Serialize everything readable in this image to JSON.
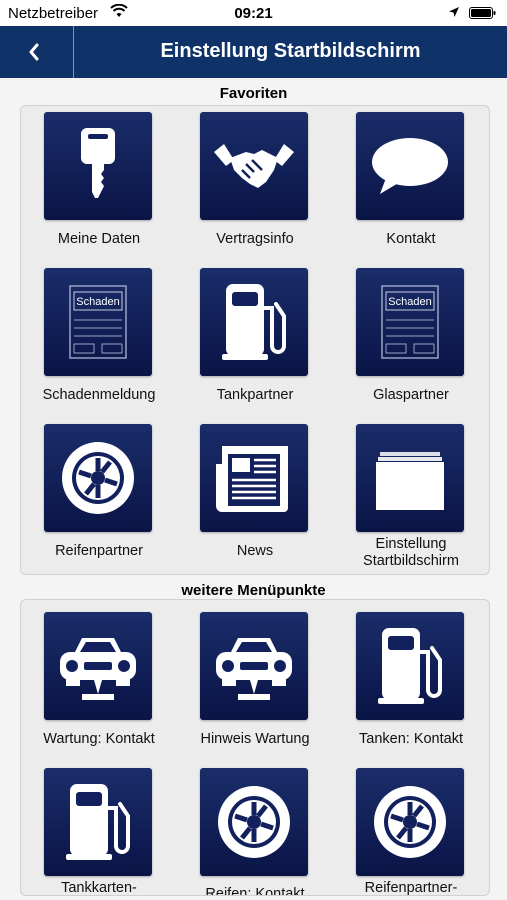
{
  "status_bar": {
    "carrier": "Netzbetreiber",
    "time": "09:21"
  },
  "nav": {
    "title": "Einstellung Startbildschirm"
  },
  "sections": {
    "favorites": {
      "header": "Favoriten",
      "items": [
        {
          "label": "Meine Daten",
          "icon": "key-icon"
        },
        {
          "label": "Vertragsinfo",
          "icon": "handshake-icon"
        },
        {
          "label": "Kontakt",
          "icon": "speech-bubble-icon"
        },
        {
          "label": "Schadenmeldung",
          "icon": "damage-form-icon",
          "icon_text": "Schaden"
        },
        {
          "label": "Tankpartner",
          "icon": "fuel-pump-icon"
        },
        {
          "label": "Glaspartner",
          "icon": "damage-form-icon",
          "icon_text": "Schaden"
        },
        {
          "label": "Reifenpartner",
          "icon": "tire-icon"
        },
        {
          "label": "News",
          "icon": "newspaper-icon"
        },
        {
          "label_line1": "Einstellung",
          "label_line2": "Startbildschirm",
          "icon": "stacked-cards-icon"
        }
      ]
    },
    "more": {
      "header": "weitere Menüpunkte",
      "items": [
        {
          "label": "Wartung: Kontakt",
          "icon": "car-lift-icon"
        },
        {
          "label": "Hinweis Wartung",
          "icon": "car-lift-icon"
        },
        {
          "label": "Tanken: Kontakt",
          "icon": "fuel-pump-icon"
        },
        {
          "label": "Tankkarten-",
          "icon": "fuel-pump-icon"
        },
        {
          "label": "Reifen: Kontakt",
          "icon": "tire-icon"
        },
        {
          "label": "Reifenpartner-",
          "icon": "tire-icon"
        }
      ]
    }
  },
  "colors": {
    "navbar": "#0f3368",
    "tile": "#0f1a55",
    "background": "#f4f4f4"
  }
}
